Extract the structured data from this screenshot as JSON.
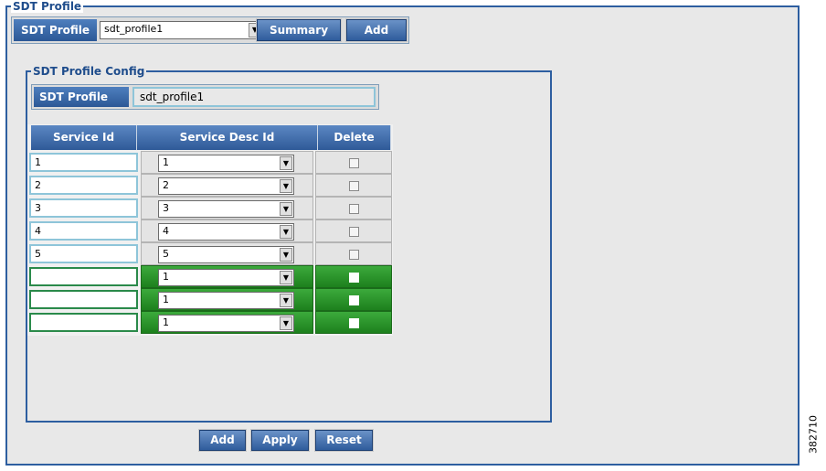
{
  "outer_title": "SDT Profile",
  "header": {
    "label": "SDT Profile",
    "selected_profile": "sdt_profile1",
    "summary_label": "Summary",
    "add_label": "Add"
  },
  "config": {
    "title": "SDT Profile Config",
    "profile_label": "SDT Profile",
    "profile_value": "sdt_profile1"
  },
  "table": {
    "headers": [
      "Service Id",
      "Service Desc Id",
      "Delete"
    ],
    "rows": [
      {
        "service_id": "1",
        "desc_id": "1",
        "new": false
      },
      {
        "service_id": "2",
        "desc_id": "2",
        "new": false
      },
      {
        "service_id": "3",
        "desc_id": "3",
        "new": false
      },
      {
        "service_id": "4",
        "desc_id": "4",
        "new": false
      },
      {
        "service_id": "5",
        "desc_id": "5",
        "new": false
      },
      {
        "service_id": "",
        "desc_id": "1",
        "new": true
      },
      {
        "service_id": "",
        "desc_id": "1",
        "new": true
      },
      {
        "service_id": "",
        "desc_id": "1",
        "new": true
      }
    ]
  },
  "footer": {
    "add_label": "Add",
    "apply_label": "Apply",
    "reset_label": "Reset"
  },
  "figure_number": "382710",
  "colors": {
    "accent": "#2c5896",
    "new_row": "#1d801d"
  },
  "icons": {
    "dropdown": "chevron-down-icon",
    "checkbox": "checkbox-icon"
  }
}
